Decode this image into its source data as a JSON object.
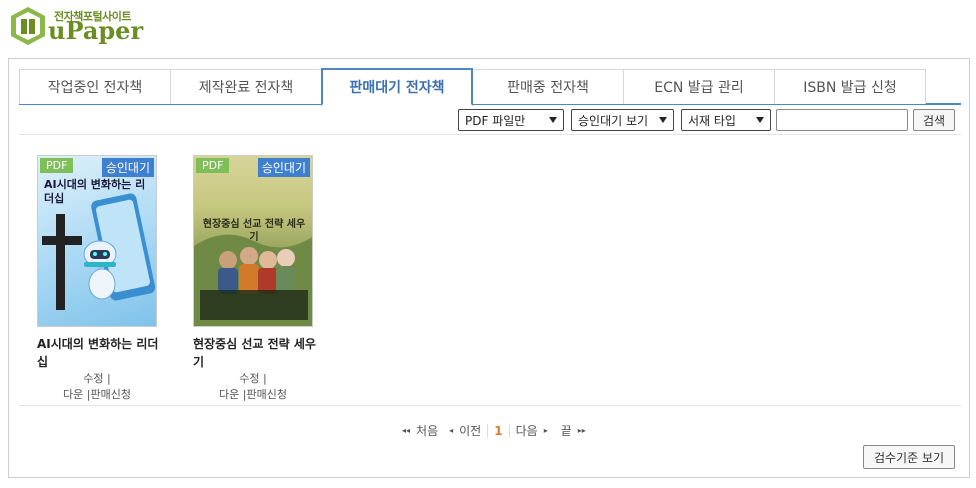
{
  "logo": {
    "subtitle": "전자책포털사이트",
    "brand": "uPaper",
    "icon": "book-logo-icon"
  },
  "tabs": [
    {
      "label": "작업중인 전자책",
      "active": false
    },
    {
      "label": "제작완료 전자책",
      "active": false
    },
    {
      "label": "판매대기 전자책",
      "active": true
    },
    {
      "label": "판매중 전자책",
      "active": false
    },
    {
      "label": "ECN 발급 관리",
      "active": false
    },
    {
      "label": "ISBN 발급 신청",
      "active": false
    }
  ],
  "filters": {
    "file_type": "PDF 파일만",
    "status_view": "승인대기 보기",
    "shelf_type": "서재 타입",
    "search_value": "",
    "search_label": "검색"
  },
  "books": [
    {
      "format": "PDF",
      "status": "승인대기",
      "title": "AI시대의 변화하는 리더십",
      "cover_title": "AI시대의 변화하는 리더십",
      "actions": {
        "edit": "수정",
        "download": "다운",
        "sell_request": "판매신청"
      }
    },
    {
      "format": "PDF",
      "status": "승인대기",
      "title": "현장중심 선교 전략 세우기",
      "cover_title": "현장중심 선교 전략 세우기",
      "actions": {
        "edit": "수정",
        "download": "다운",
        "sell_request": "판매신청"
      }
    }
  ],
  "pagination": {
    "first": "처음",
    "prev": "이전",
    "current": "1",
    "next": "다음",
    "last": "끝"
  },
  "criteria_button": "검수기준 보기",
  "colors": {
    "accent": "#4a86c8",
    "pdf_badge": "#7fbf5a",
    "status_badge": "#3f7fd0",
    "page_current": "#e07b2a",
    "brand": "#6b8e23"
  }
}
